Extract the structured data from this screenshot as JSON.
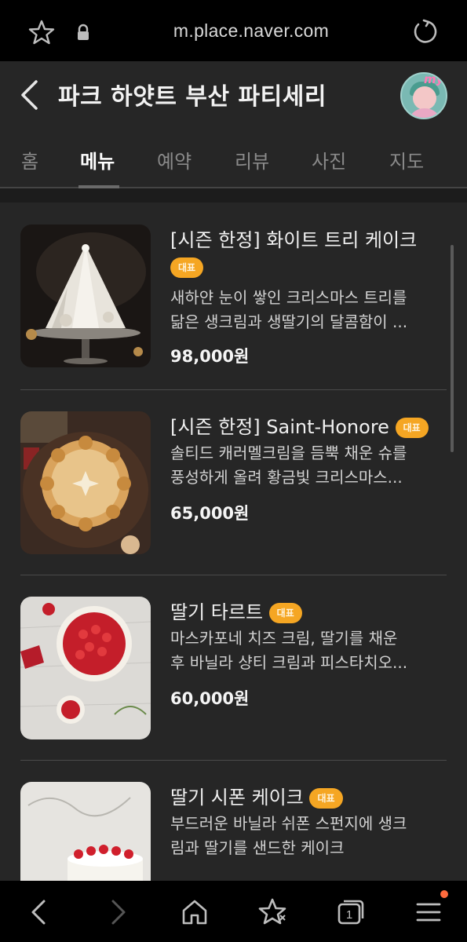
{
  "browser": {
    "url": "m.place.naver.com",
    "tab_count": "1",
    "icons": [
      "star-icon",
      "lock-icon",
      "reload-icon",
      "back-icon",
      "forward-icon",
      "home-icon",
      "bookmark-icon",
      "tabs-icon",
      "menu-icon"
    ]
  },
  "header": {
    "title": "파크 하얏트 부산 파티세리",
    "avatar_badge": "my"
  },
  "tabs": [
    {
      "label": "홈",
      "active": false
    },
    {
      "label": "메뉴",
      "active": true
    },
    {
      "label": "예약",
      "active": false
    },
    {
      "label": "리뷰",
      "active": false
    },
    {
      "label": "사진",
      "active": false
    },
    {
      "label": "지도",
      "active": false
    }
  ],
  "menu": {
    "badge_label": "대표",
    "items": [
      {
        "name": "[시즌 한정] 화이트 트리 케이크",
        "desc_line1": "새하얀 눈이 쌓인 크리스마스 트리를",
        "desc_line2": "닮은 생크림과 생딸기의 달콤함이 ...",
        "price": "98,000원"
      },
      {
        "name": "[시즌 한정] Saint-Honore",
        "desc_line1": "솔티드 캐러멜크림을 듬뿍 채운 슈를",
        "desc_line2": "풍성하게 올려 황금빛 크리스마스...",
        "price": "65,000원"
      },
      {
        "name": "딸기 타르트",
        "desc_line1": "마스카포네 치즈 크림, 딸기를 채운",
        "desc_line2": "후 바닐라 샹티 크림과 피스타치오...",
        "price": "60,000원"
      },
      {
        "name": "딸기 시폰 케이크",
        "desc_line1": "부드러운 바닐라 쉬폰 스펀지에 생크",
        "desc_line2": "림과 딸기를 샌드한 케이크",
        "price": ""
      }
    ]
  },
  "colors": {
    "background": "#262626",
    "badge": "#f5a623",
    "notification_dot": "#ff6b3d"
  }
}
